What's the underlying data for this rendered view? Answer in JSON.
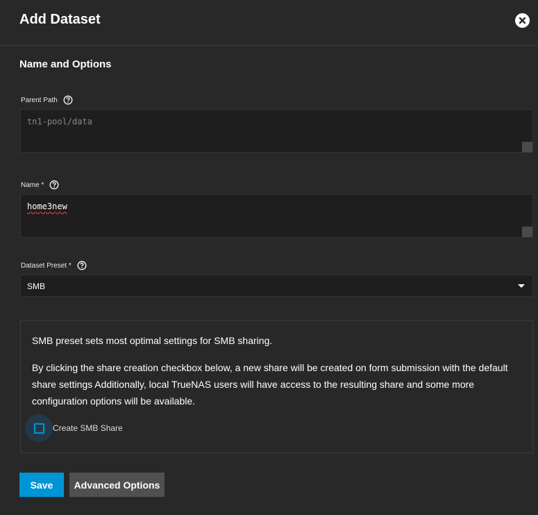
{
  "header": {
    "title": "Add Dataset",
    "close_icon": "close-icon"
  },
  "section": {
    "title": "Name and Options"
  },
  "fields": {
    "parent_path": {
      "label": "Parent Path",
      "placeholder": "tn1-pool/data",
      "help_icon": "help-circle-icon"
    },
    "name": {
      "label": "Name *",
      "value": "home3new",
      "help_icon": "help-circle-icon"
    },
    "preset": {
      "label": "Dataset Preset *",
      "value": "SMB",
      "help_icon": "help-circle-icon"
    }
  },
  "info": {
    "line1": "SMB preset sets most optimal settings for SMB sharing.",
    "line2": "By clicking the share creation checkbox below, a new share will be created on form submission with the default share settings Additionally, local TrueNAS users will have access to the resulting share and some more configuration options will be available.",
    "checkbox_label": "Create SMB Share",
    "checkbox_checked": false
  },
  "buttons": {
    "save": "Save",
    "advanced": "Advanced Options"
  },
  "colors": {
    "background": "#282828",
    "input_bg": "#1e1e1e",
    "accent": "#0095d5",
    "secondary_button": "#505050"
  }
}
